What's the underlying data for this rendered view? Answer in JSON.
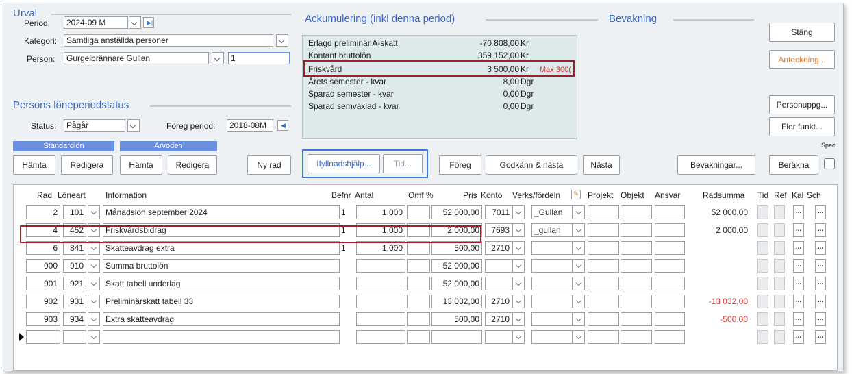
{
  "urval": {
    "title": "Urval",
    "period_label": "Period:",
    "period_value": "2024-09 M",
    "kategori_label": "Kategori:",
    "kategori_value": "Samtliga anställda personer",
    "person_label": "Person:",
    "person_value": "Gurgelbrännare Gullan",
    "person_number": "1"
  },
  "status_section": {
    "title": "Persons löneperiodstatus",
    "status_label": "Status:",
    "status_value": "Pågår",
    "prev_label": "Föreg period:",
    "prev_value": "2018-08M"
  },
  "groups": {
    "standardlon": "Standardlön",
    "arvoden": "Arvoden",
    "hamta1": "Hämta",
    "redigera1": "Redigera",
    "hamta2": "Hämta",
    "redigera2": "Redigera",
    "ny_rad": "Ny rad"
  },
  "accum": {
    "title": "Ackumulering (inkl denna period)",
    "rows": [
      {
        "name": "Erlagd preliminär A-skatt",
        "value": "-70 808,00",
        "unit": "Kr",
        "limit": ""
      },
      {
        "name": "Kontant bruttolön",
        "value": "359 152,00",
        "unit": "Kr",
        "limit": ""
      },
      {
        "name": "Friskvård",
        "value": "3 500,00",
        "unit": "Kr",
        "limit": "Max 300("
      },
      {
        "name": "Årets semester - kvar",
        "value": "8,00",
        "unit": "Dgr",
        "limit": ""
      },
      {
        "name": "Sparad semester - kvar",
        "value": "0,00",
        "unit": "Dgr",
        "limit": ""
      },
      {
        "name": "Sparad semväxlad - kvar",
        "value": "0,00",
        "unit": "Dgr",
        "limit": ""
      }
    ]
  },
  "bevakning": {
    "title": "Bevakning"
  },
  "right_buttons": {
    "stang": "Stäng",
    "anteckning": "Anteckning...",
    "personuppg": "Personuppg...",
    "fler_funkt": "Fler funkt...",
    "spec": "Spec",
    "berakna": "Beräkna"
  },
  "toolbar": {
    "ifyllnad": "Ifyllnadshjälp...",
    "tid": "Tid...",
    "foreg": "Föreg",
    "godkann": "Godkänn & nästa",
    "nasta": "Nästa",
    "bevakningar": "Bevakningar..."
  },
  "grid": {
    "headers": {
      "rad": "Rad",
      "loneart": "Löneart",
      "information": "Information",
      "befnr": "Befnr",
      "antal": "Antal",
      "omf": "Omf %",
      "pris": "Pris",
      "konto": "Konto",
      "verks": "Verks/fördeln",
      "projekt": "Projekt",
      "objekt": "Objekt",
      "ansvar": "Ansvar",
      "radsumma": "Radsumma",
      "tid": "Tid",
      "ref": "Ref",
      "kal": "Kal",
      "sch": "Sch"
    },
    "dots": "...",
    "rows": [
      {
        "rad": "2",
        "loneart": "101",
        "info": "Månadslön september 2024",
        "befnr": "1",
        "antal": "1,000",
        "pris": "52 000,00",
        "konto": "7011",
        "verks": "_Gullan",
        "radsumma": "52 000,00",
        "neg": false
      },
      {
        "rad": "4",
        "loneart": "452",
        "info": "Friskvårdsbidrag",
        "befnr": "1",
        "antal": "1,000",
        "pris": "2 000,00",
        "konto": "7693",
        "verks": "_gullan",
        "radsumma": "2 000,00",
        "neg": false
      },
      {
        "rad": "6",
        "loneart": "841",
        "info": "Skatteavdrag extra",
        "befnr": "1",
        "antal": "1,000",
        "pris": "500,00",
        "konto": "2710",
        "verks": "",
        "radsumma": "",
        "neg": false
      },
      {
        "rad": "900",
        "loneart": "910",
        "info": "Summa bruttolön",
        "befnr": "",
        "antal": "",
        "pris": "52 000,00",
        "konto": "",
        "verks": "",
        "radsumma": "",
        "neg": false
      },
      {
        "rad": "901",
        "loneart": "921",
        "info": "Skatt tabell underlag",
        "befnr": "",
        "antal": "",
        "pris": "52 000,00",
        "konto": "",
        "verks": "",
        "radsumma": "",
        "neg": false
      },
      {
        "rad": "902",
        "loneart": "931",
        "info": "Preliminärskatt tabell 33",
        "befnr": "",
        "antal": "",
        "pris": "13 032,00",
        "konto": "2710",
        "verks": "",
        "radsumma": "-13 032,00",
        "neg": true
      },
      {
        "rad": "903",
        "loneart": "934",
        "info": "Extra skatteavdrag",
        "befnr": "",
        "antal": "",
        "pris": "500,00",
        "konto": "2710",
        "verks": "",
        "radsumma": "-500,00",
        "neg": true
      },
      {
        "rad": "",
        "loneart": "",
        "info": "",
        "befnr": "",
        "antal": "",
        "pris": "",
        "konto": "",
        "verks": "",
        "radsumma": "",
        "neg": false
      }
    ]
  }
}
